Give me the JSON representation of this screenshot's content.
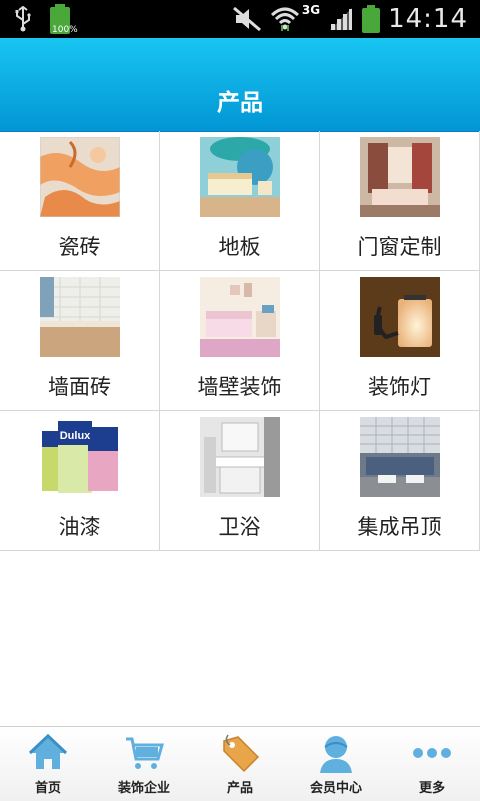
{
  "status_bar": {
    "battery_percent": "100%",
    "network": "3G",
    "time": "14:14"
  },
  "header": {
    "title": "产品"
  },
  "categories": [
    {
      "label": "瓷砖",
      "icon": "tile-photo"
    },
    {
      "label": "地板",
      "icon": "floor-photo"
    },
    {
      "label": "门窗定制",
      "icon": "door-window-photo"
    },
    {
      "label": "墙面砖",
      "icon": "wall-tile-photo"
    },
    {
      "label": "墙壁装饰",
      "icon": "wall-decor-photo"
    },
    {
      "label": "装饰灯",
      "icon": "decor-lamp-photo"
    },
    {
      "label": "油漆",
      "icon": "paint-photo"
    },
    {
      "label": "卫浴",
      "icon": "bathroom-photo"
    },
    {
      "label": "集成吊顶",
      "icon": "ceiling-photo"
    }
  ],
  "paint_brand": "Dulux",
  "bottom_nav": [
    {
      "label": "首页",
      "icon": "home-icon"
    },
    {
      "label": "装饰企业",
      "icon": "cart-icon"
    },
    {
      "label": "产品",
      "icon": "tag-icon"
    },
    {
      "label": "会员中心",
      "icon": "user-icon"
    },
    {
      "label": "更多",
      "icon": "more-icon"
    }
  ],
  "colors": {
    "header_top": "#19c5f1",
    "header_bottom": "#0196d5",
    "nav_icon": "#5fb0de",
    "tag_icon": "#e8a54a"
  }
}
